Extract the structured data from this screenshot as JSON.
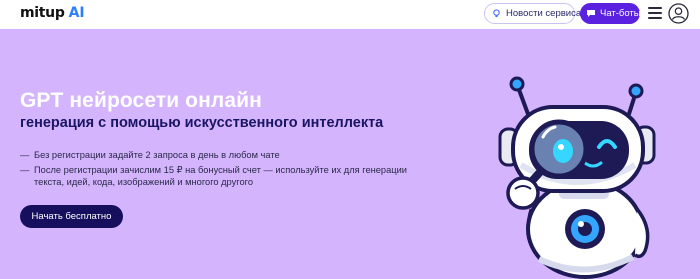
{
  "header": {
    "logo": {
      "main": "mitup",
      "accent": "AI"
    },
    "news_button": {
      "label": "Новости сервиса",
      "icon": "lightbulb-icon"
    },
    "chat_button": {
      "label": "Чат-боты",
      "icon": "chat-bubble-icon"
    },
    "menu_icon": "hamburger-icon",
    "avatar_icon": "user-avatar-icon"
  },
  "hero": {
    "title": "GPT нейросети онлайн",
    "subtitle": "генерация с помощью искусственного интеллекта",
    "bullets": [
      {
        "dash": "—",
        "text": "Без регистрации задайте 2 запроса в день в любом чате"
      },
      {
        "dash": "—",
        "text": "После регистрации зачислим 15 ₽ на бонусный счет — используйте их для генерации текста, идей, кода, изображений и многого другого"
      }
    ],
    "cta_label": "Начать бесплатно",
    "illustration": "robot-with-magnifier-illustration"
  },
  "colors": {
    "hero_bg": "#d4b4fd",
    "accent_purple": "#5b21e0",
    "navy": "#150f5e",
    "logo_ai": "#2b7fff"
  }
}
